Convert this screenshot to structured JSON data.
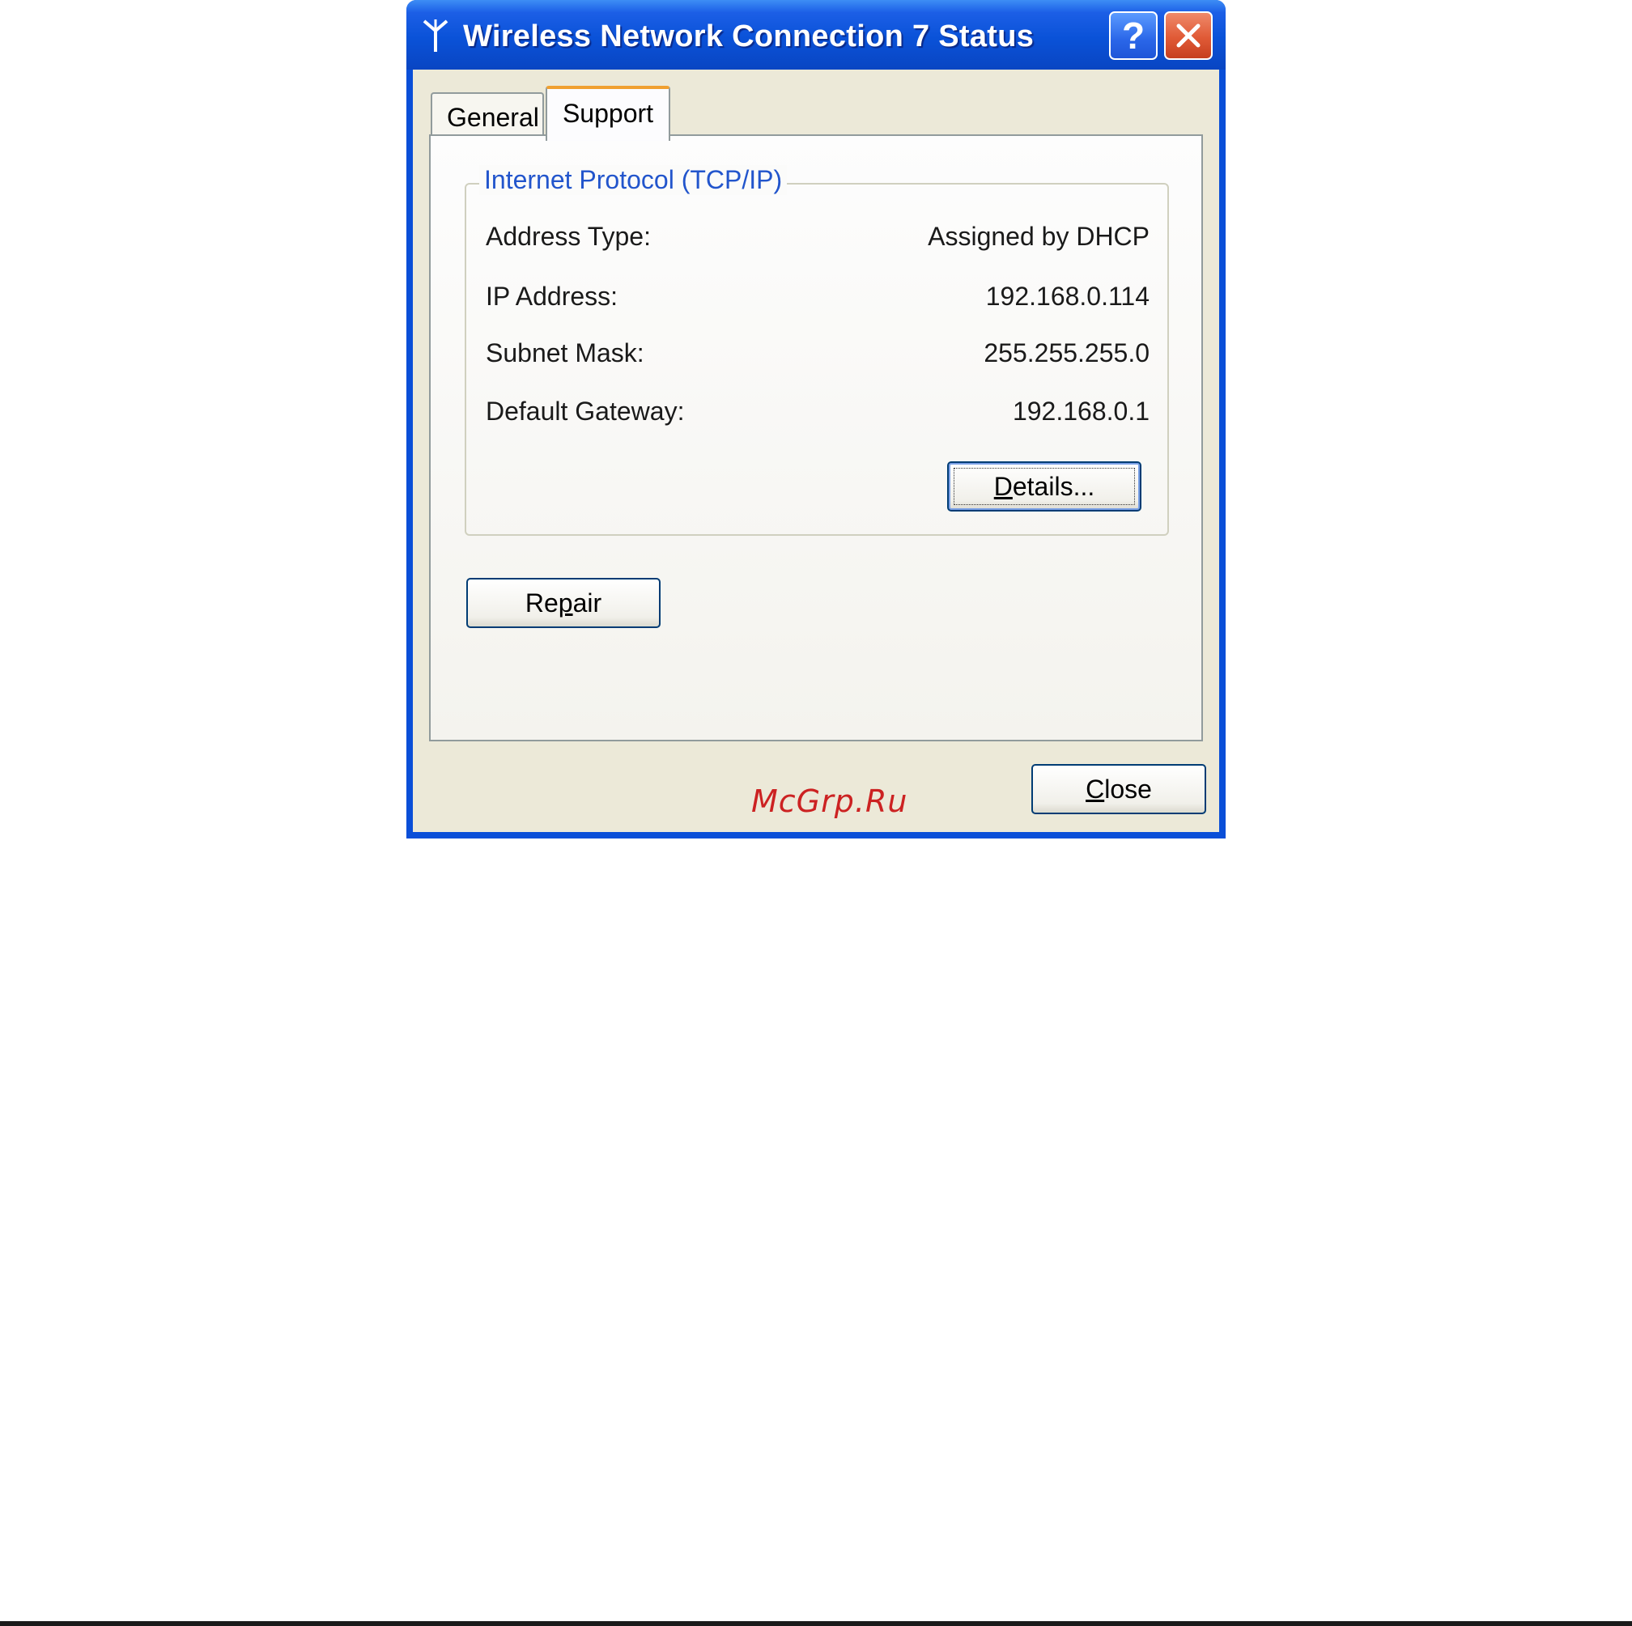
{
  "window": {
    "title": "Wireless Network Connection 7 Status",
    "help_button": "?",
    "colors": {
      "titlebar": "#0a52d8",
      "client": "#ece9d8",
      "close": "#e05a36",
      "group_label": "#2255cc"
    }
  },
  "tabs": [
    {
      "label": "General",
      "selected": false
    },
    {
      "label": "Support",
      "selected": true
    }
  ],
  "group": {
    "legend": "Internet Protocol (TCP/IP)",
    "rows": [
      {
        "label": "Address Type:",
        "value": "Assigned by DHCP"
      },
      {
        "label": "IP Address:",
        "value": "192.168.0.114"
      },
      {
        "label": "Subnet Mask:",
        "value": "255.255.255.0"
      },
      {
        "label": "Default Gateway:",
        "value": "192.168.0.1"
      }
    ]
  },
  "buttons": {
    "details": {
      "label": "Details...",
      "mnemonic": "D",
      "rest": "etails..."
    },
    "repair": {
      "pre": "Re",
      "mnemonic": "p",
      "post": "air"
    },
    "close": {
      "mnemonic": "C",
      "rest": "lose"
    }
  },
  "watermark": "McGrp.Ru"
}
